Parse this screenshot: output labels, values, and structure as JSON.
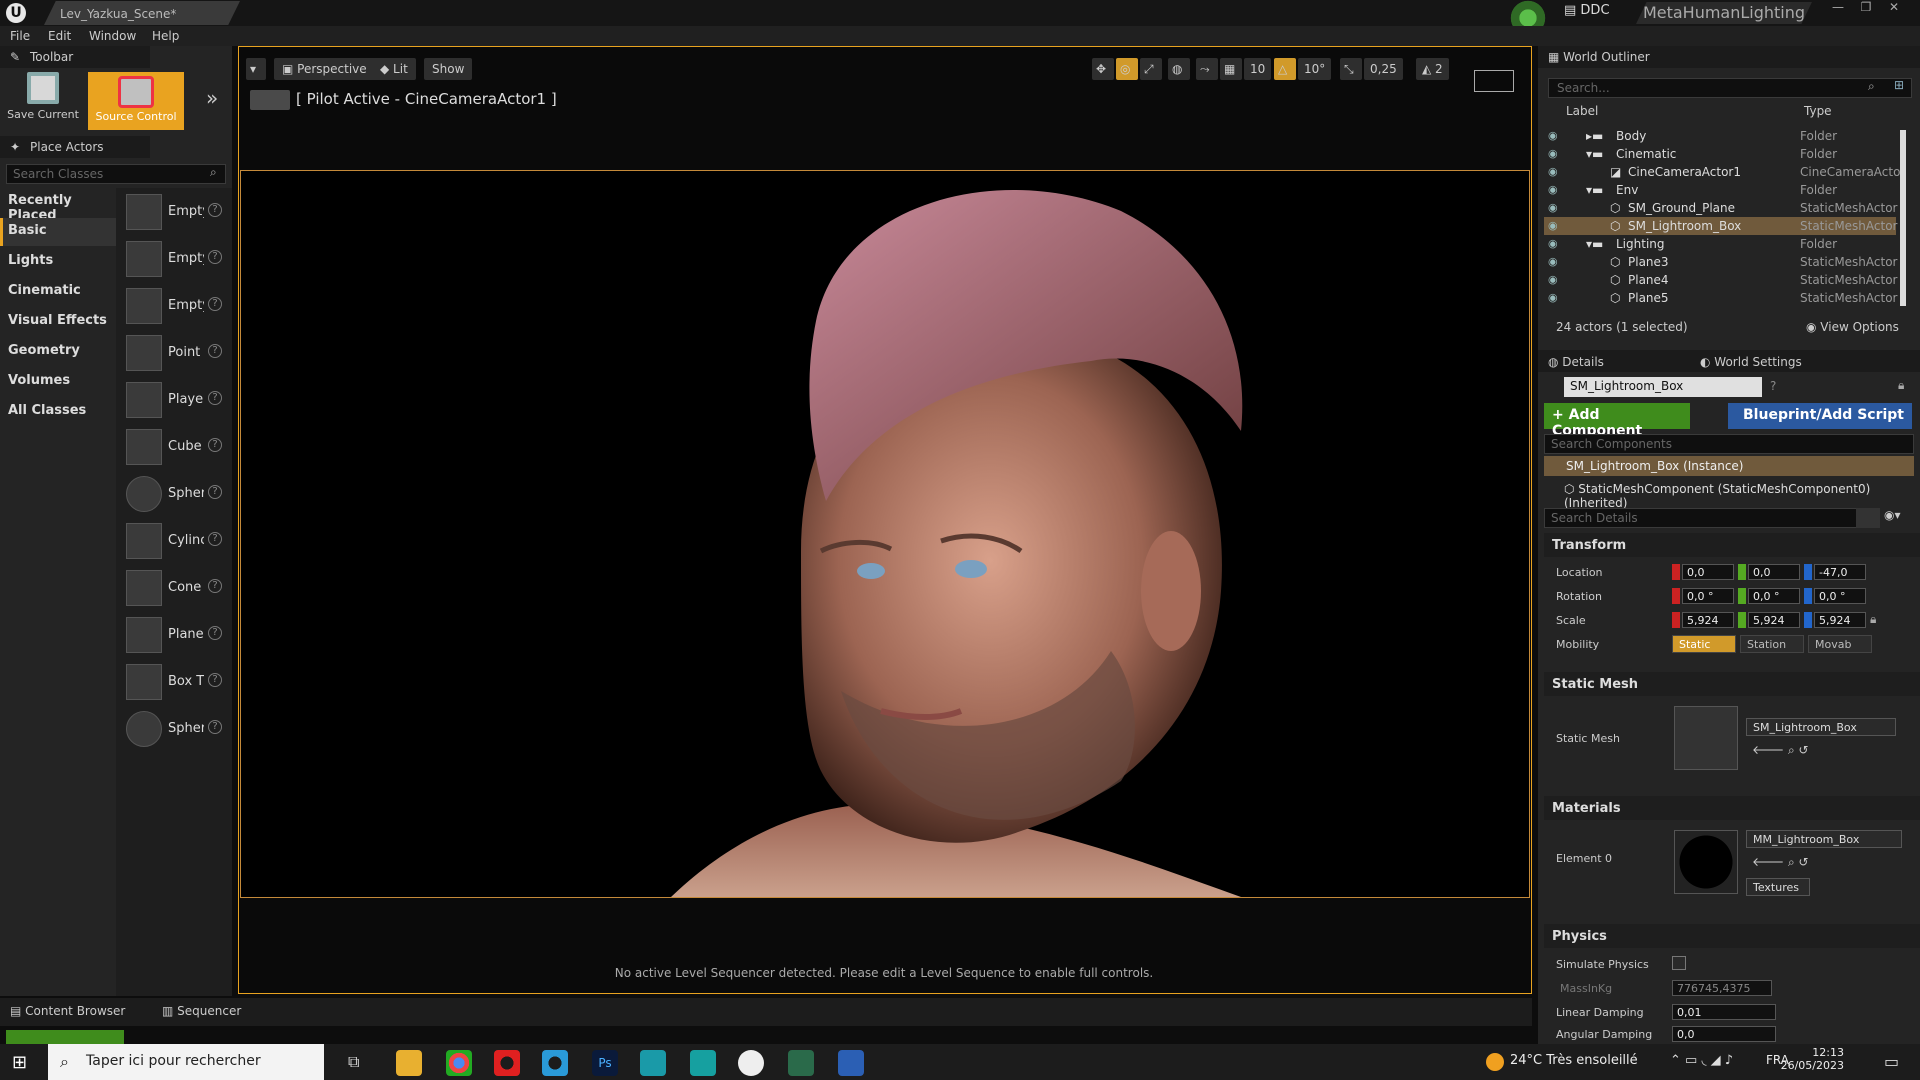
{
  "titlebar": {
    "document_tab": "Lev_Yazkua_Scene*",
    "ddc_label": "DDC",
    "project_name": "MetaHumanLighting"
  },
  "menu": [
    "File",
    "Edit",
    "Window",
    "Help"
  ],
  "toolbar": {
    "title": "Toolbar",
    "save_label": "Save Current",
    "source_control_label": "Source Control"
  },
  "place_actors": {
    "title": "Place Actors",
    "search_placeholder": "Search Classes",
    "categories": [
      "Recently Placed",
      "Basic",
      "Lights",
      "Cinematic",
      "Visual Effects",
      "Geometry",
      "Volumes",
      "All Classes"
    ],
    "active_category": "Basic",
    "items": [
      "Empty",
      "Empty",
      "Empty",
      "Point",
      "Playe",
      "Cube",
      "Spher",
      "Cylinc",
      "Cone",
      "Plane",
      "Box T",
      "Spher"
    ]
  },
  "viewport": {
    "perspective_label": "Perspective",
    "lit_label": "Lit",
    "show_label": "Show",
    "grid_snap": "10",
    "rotation_snap": "10°",
    "scale_snap": "0,25",
    "camera_speed": "2",
    "pilot_text": "[ Pilot Active - CineCameraActor1 ]",
    "message": "No active Level Sequencer detected. Please edit a Level Sequence to enable full controls."
  },
  "bottom_tabs": {
    "content_browser": "Content Browser",
    "sequencer": "Sequencer"
  },
  "world_outliner": {
    "title": "World Outliner",
    "search_placeholder": "Search...",
    "col_label": "Label",
    "col_type": "Type",
    "rows": [
      {
        "label": "Body",
        "type": "Folder"
      },
      {
        "label": "Cinematic",
        "type": "Folder"
      },
      {
        "label": "CineCameraActor1",
        "type": "CineCameraActor"
      },
      {
        "label": "Env",
        "type": "Folder"
      },
      {
        "label": "SM_Ground_Plane",
        "type": "StaticMeshActor"
      },
      {
        "label": "SM_Lightroom_Box",
        "type": "StaticMeshActor"
      },
      {
        "label": "Lighting",
        "type": "Folder"
      },
      {
        "label": "Plane3",
        "type": "StaticMeshActor"
      },
      {
        "label": "Plane4",
        "type": "StaticMeshActor"
      },
      {
        "label": "Plane5",
        "type": "StaticMeshActor"
      }
    ],
    "count_text": "24 actors (1 selected)",
    "view_options": "View Options"
  },
  "details": {
    "tab_details": "Details",
    "tab_world_settings": "World Settings",
    "actor_name": "SM_Lightroom_Box",
    "add_component": "+ Add Component",
    "blueprint_script": "Blueprint/Add Script",
    "search_components": "Search Components",
    "instance_label": "SM_Lightroom_Box (Instance)",
    "component_label": "StaticMeshComponent (StaticMeshComponent0) (Inherited)",
    "search_details": "Search Details",
    "transform_title": "Transform",
    "location_label": "Location",
    "rotation_label": "Rotation",
    "scale_label": "Scale",
    "mobility_label": "Mobility",
    "location": [
      "0,0",
      "0,0",
      "-47,0"
    ],
    "rotation": [
      "0,0 °",
      "0,0 °",
      "0,0 °"
    ],
    "scale": [
      "5,924",
      "5,924",
      "5,924"
    ],
    "mobility": [
      "Static",
      "Station",
      "Movab"
    ],
    "static_mesh_title": "Static Mesh",
    "static_mesh_label": "Static Mesh",
    "static_mesh_value": "SM_Lightroom_Box",
    "materials_title": "Materials",
    "element0_label": "Element 0",
    "material_value": "MM_Lightroom_Box",
    "textures_label": "Textures",
    "physics_title": "Physics",
    "simulate_physics": "Simulate Physics",
    "mass_label": "MassInKg",
    "mass_value": "776745,4375",
    "linear_damping_label": "Linear Damping",
    "linear_damping_value": "0,01",
    "angular_damping_label": "Angular Damping",
    "angular_damping_value": "0,0"
  },
  "taskbar": {
    "search_placeholder": "Taper ici pour rechercher",
    "weather": "24°C  Très ensoleillé",
    "language": "FRA",
    "time": "12:13",
    "date": "26/05/2023"
  },
  "colors": {
    "accent": "#e9a320",
    "selection": "#705a3c",
    "add_component": "#3f8c1c",
    "blueprint": "#2b59a0"
  }
}
